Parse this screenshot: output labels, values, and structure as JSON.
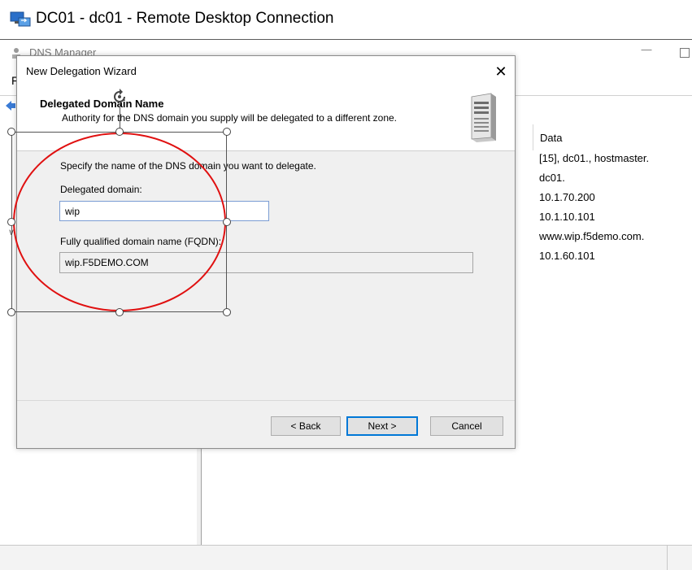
{
  "rdp": {
    "title": "DC01 - dc01 - Remote Desktop Connection"
  },
  "dns_manager": {
    "title": "DNS Manager",
    "minimize": "—",
    "menu_letter": "F",
    "tree_expander": "∨",
    "list_header": "Data",
    "data_rows": [
      "[15], dc01., hostmaster.",
      "dc01.",
      "10.1.70.200",
      "10.1.10.101",
      "www.wip.f5demo.com.",
      "10.1.60.101"
    ]
  },
  "wizard": {
    "title": "New Delegation Wizard",
    "close": "✕",
    "header_title": "Delegated Domain Name",
    "header_subtitle": "Authority for the DNS domain you supply will be delegated to a different zone.",
    "instruction": "Specify the name of the DNS domain you want to delegate.",
    "delegated_domain_label": "Delegated domain:",
    "delegated_domain_value": "wip",
    "fqdn_label": "Fully qualified domain name (FQDN):",
    "fqdn_value": "wip.F5DEMO.COM",
    "buttons": {
      "back": "< Back",
      "next": "Next >",
      "cancel": "Cancel"
    }
  },
  "colors": {
    "annotation_ellipse": "#e01010",
    "focus_blue": "#0078d7"
  }
}
